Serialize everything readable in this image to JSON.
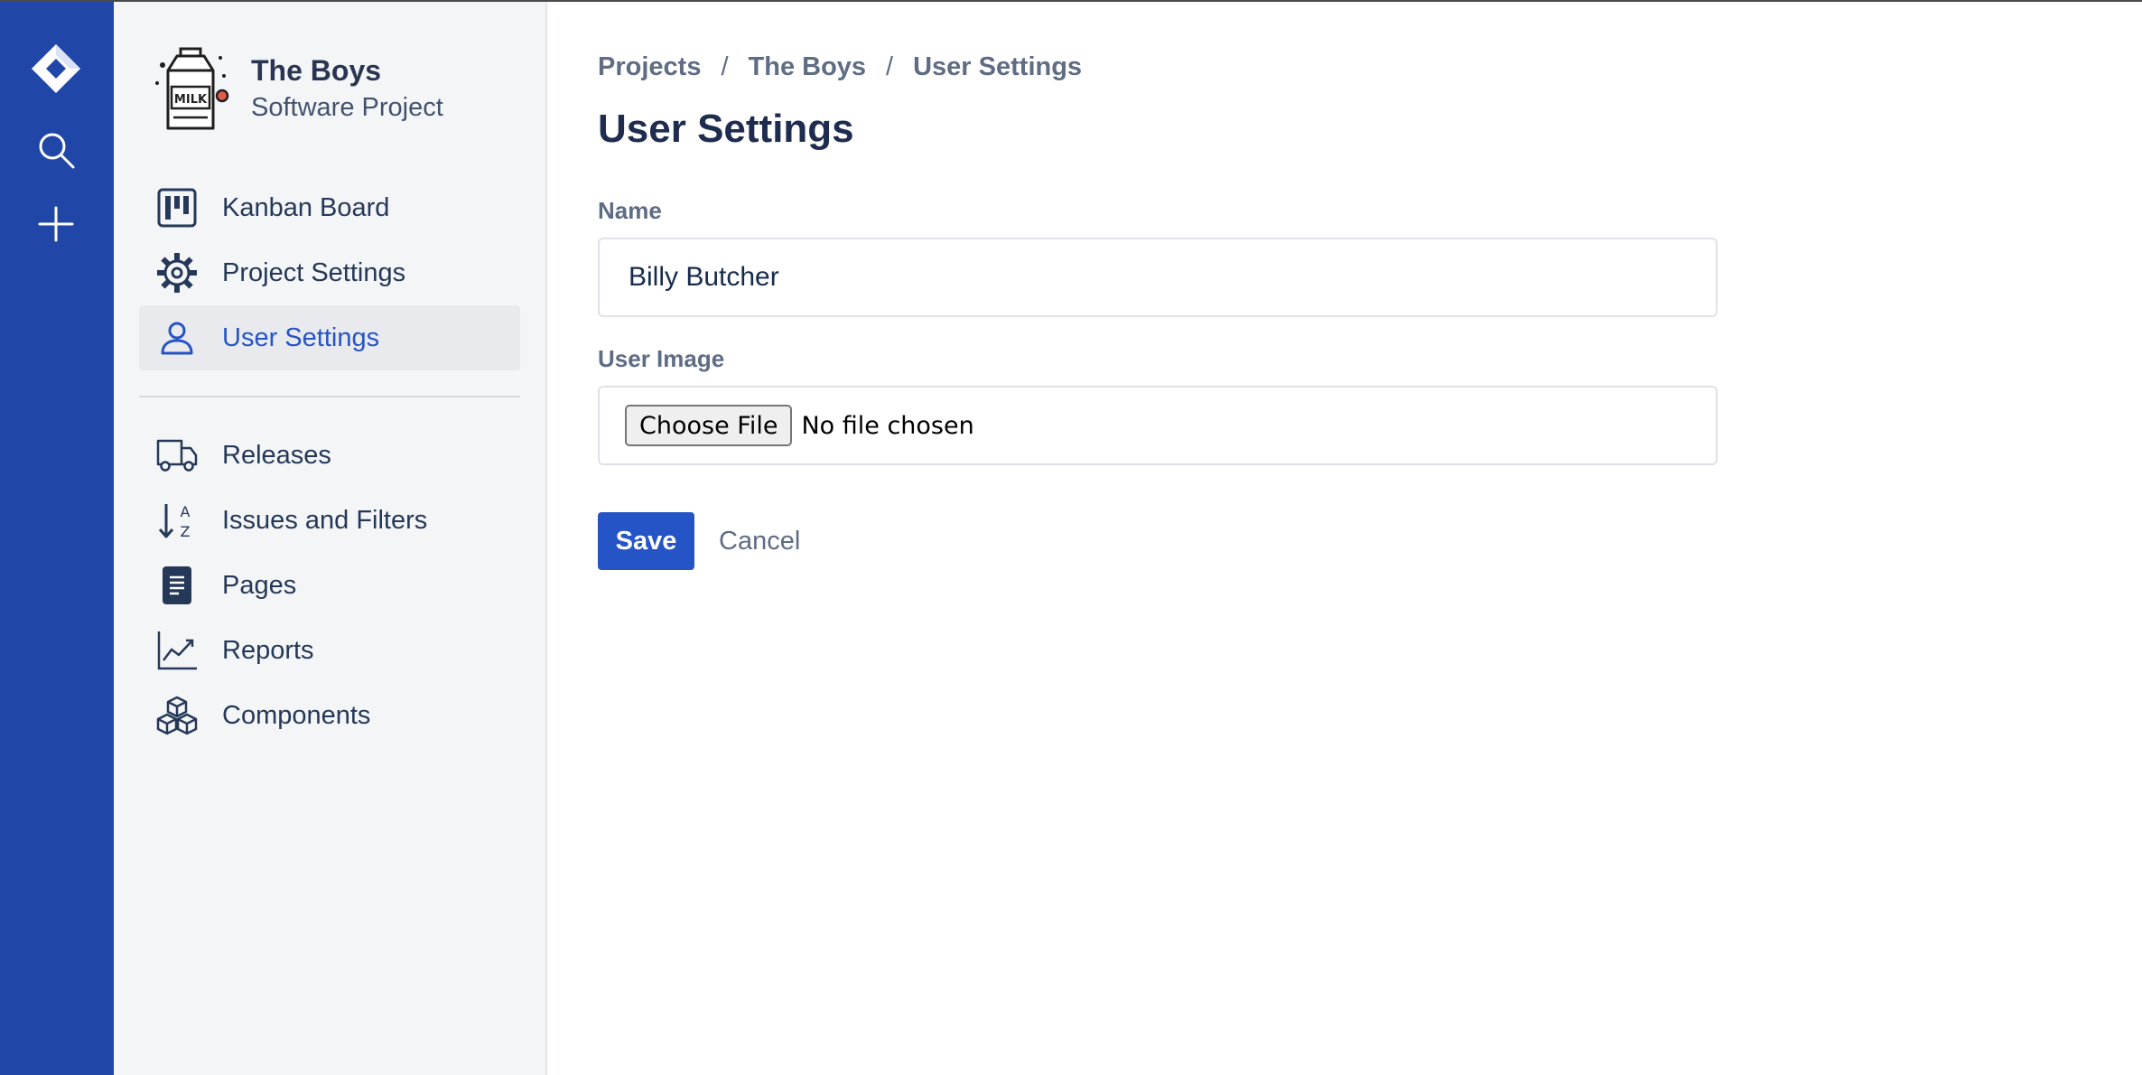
{
  "global_nav": {
    "logo_icon": "jira-diamond-icon",
    "search_icon": "search-icon",
    "create_icon": "plus-icon",
    "background_color": "#2046a8"
  },
  "project": {
    "name": "The Boys",
    "type": "Software Project",
    "avatar_icon": "milk-carton-icon",
    "avatar_text": "MILK"
  },
  "sidebar": {
    "primary_items": [
      {
        "label": "Kanban Board",
        "icon": "board-icon"
      },
      {
        "label": "Project Settings",
        "icon": "gear-icon"
      },
      {
        "label": "User Settings",
        "icon": "user-icon",
        "active": true
      }
    ],
    "secondary_items": [
      {
        "label": "Releases",
        "icon": "truck-icon"
      },
      {
        "label": "Issues and Filters",
        "icon": "sort-az-icon"
      },
      {
        "label": "Pages",
        "icon": "page-icon"
      },
      {
        "label": "Reports",
        "icon": "chart-line-icon"
      },
      {
        "label": "Components",
        "icon": "cubes-icon"
      }
    ],
    "active_color": "#2754c4"
  },
  "breadcrumb": [
    "Projects",
    "The Boys",
    "User Settings"
  ],
  "breadcrumb_separator": "/",
  "page_title": "User Settings",
  "form": {
    "name_label": "Name",
    "name_value": "Billy Butcher",
    "image_label": "User Image",
    "file_button_label": "Choose File",
    "file_status": "No file chosen",
    "save_label": "Save",
    "cancel_label": "Cancel",
    "primary_color": "#2554c7"
  }
}
